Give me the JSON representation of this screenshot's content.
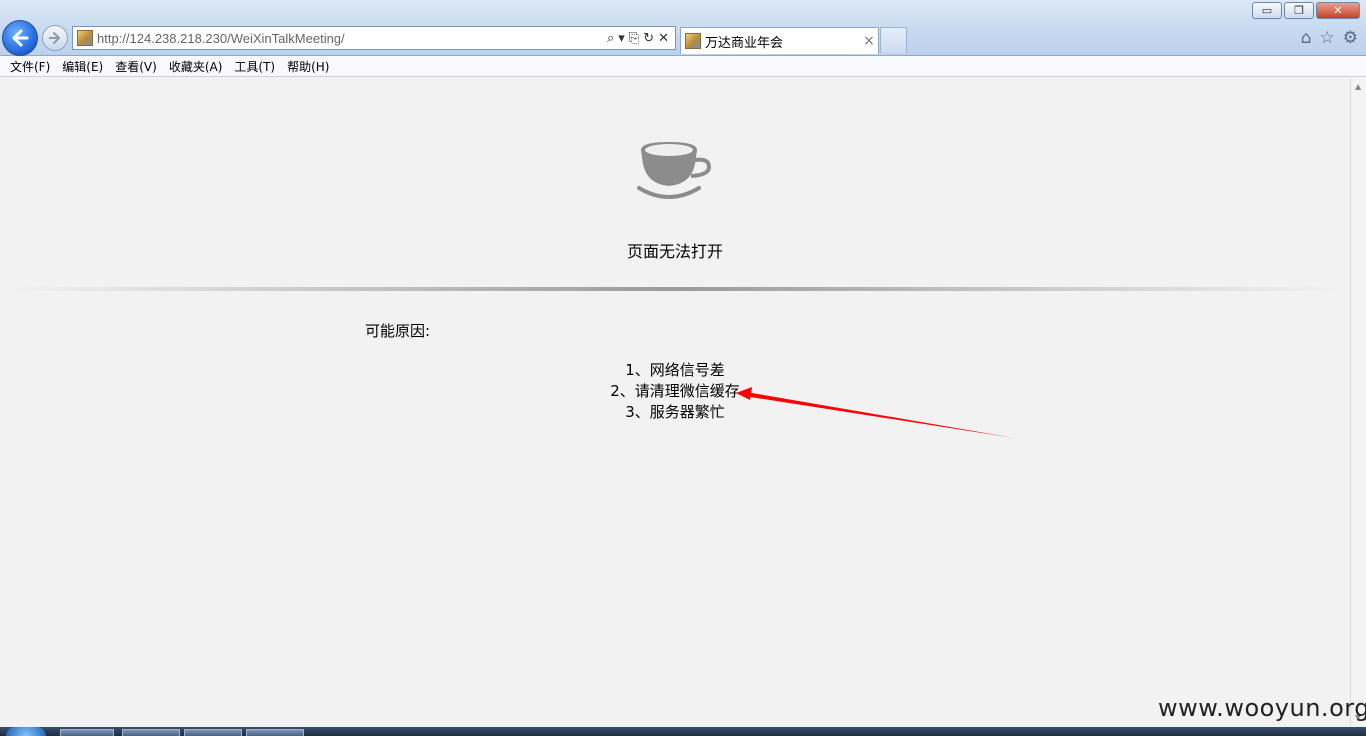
{
  "browser": {
    "url": "http://124.238.218.230/WeiXinTalkMeeting/",
    "tab_title": "万达商业年会",
    "tab_close": "×",
    "menu": [
      "文件(F)",
      "编辑(E)",
      "查看(V)",
      "收藏夹(A)",
      "工具(T)",
      "帮助(H)"
    ],
    "window_controls": {
      "minimize": "▭",
      "restore": "❐",
      "close": "✕"
    },
    "address_tools": [
      "⌕",
      "▾",
      "⎘",
      "↻",
      "✕"
    ],
    "toolbar_icons": {
      "home": "⌂",
      "favorites": "☆",
      "settings": "⚙"
    }
  },
  "page": {
    "error_title": "页面无法打开",
    "reasons_title": "可能原因:",
    "reasons": [
      "1、网络信号差",
      "2、请清理微信缓存",
      "3、服务器繁忙"
    ]
  },
  "annotation": {
    "arrow_color": "#ff0000"
  },
  "watermark": "www.wooyun.org"
}
